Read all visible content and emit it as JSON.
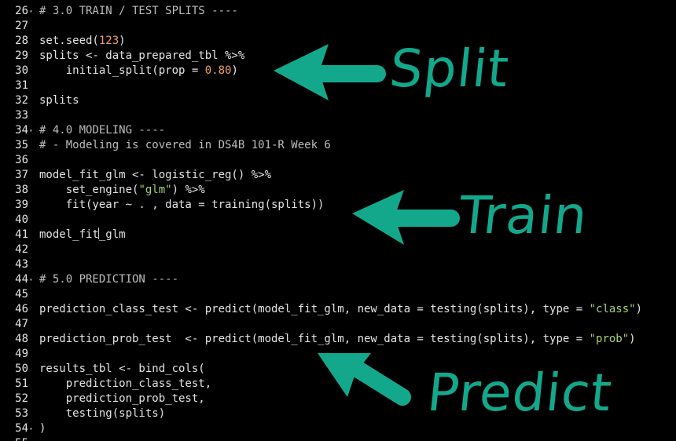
{
  "theme": {
    "background": "#000000",
    "text": "#e4e4e4",
    "comment": "#bdbdbd",
    "number": "#f0a070",
    "string": "#a9d27a",
    "annotation": "#13a88c"
  },
  "lines": [
    {
      "num": "26",
      "fold": true,
      "text": "# 3.0 TRAIN / TEST SPLITS ----"
    },
    {
      "num": "27",
      "fold": false,
      "text": ""
    },
    {
      "num": "28",
      "fold": false,
      "text": "set.seed(123)"
    },
    {
      "num": "29",
      "fold": false,
      "text": "splits <- data_prepared_tbl %>%"
    },
    {
      "num": "30",
      "fold": false,
      "text": "    initial_split(prop = 0.80)"
    },
    {
      "num": "31",
      "fold": false,
      "text": ""
    },
    {
      "num": "32",
      "fold": false,
      "text": "splits"
    },
    {
      "num": "33",
      "fold": false,
      "text": ""
    },
    {
      "num": "34",
      "fold": true,
      "text": "# 4.0 MODELING ----"
    },
    {
      "num": "35",
      "fold": false,
      "text": "# - Modeling is covered in DS4B 101-R Week 6"
    },
    {
      "num": "36",
      "fold": false,
      "text": ""
    },
    {
      "num": "37",
      "fold": false,
      "text": "model_fit_glm <- logistic_reg() %>%"
    },
    {
      "num": "38",
      "fold": false,
      "text": "    set_engine(\"glm\") %>%"
    },
    {
      "num": "39",
      "fold": false,
      "text": "    fit(year ~ . , data = training(splits))"
    },
    {
      "num": "40",
      "fold": false,
      "text": ""
    },
    {
      "num": "41",
      "fold": false,
      "text": "model_fit_glm"
    },
    {
      "num": "42",
      "fold": false,
      "text": ""
    },
    {
      "num": "43",
      "fold": false,
      "text": ""
    },
    {
      "num": "44",
      "fold": true,
      "text": "# 5.0 PREDICTION ----"
    },
    {
      "num": "45",
      "fold": false,
      "text": ""
    },
    {
      "num": "46",
      "fold": false,
      "text": "prediction_class_test <- predict(model_fit_glm, new_data = testing(splits), type = \"class\")"
    },
    {
      "num": "47",
      "fold": false,
      "text": ""
    },
    {
      "num": "48",
      "fold": false,
      "text": "prediction_prob_test  <- predict(model_fit_glm, new_data = testing(splits), type = \"prob\")"
    },
    {
      "num": "49",
      "fold": false,
      "text": ""
    },
    {
      "num": "50",
      "fold": false,
      "text": "results_tbl <- bind_cols("
    },
    {
      "num": "51",
      "fold": false,
      "text": "    prediction_class_test,"
    },
    {
      "num": "52",
      "fold": false,
      "text": "    prediction_prob_test,"
    },
    {
      "num": "53",
      "fold": false,
      "text": "    testing(splits)"
    },
    {
      "num": "54",
      "fold": true,
      "text": ")"
    },
    {
      "num": "55",
      "fold": false,
      "text": ""
    }
  ],
  "annotations": {
    "split": "Split",
    "train": "Train",
    "predict": "Predict"
  }
}
